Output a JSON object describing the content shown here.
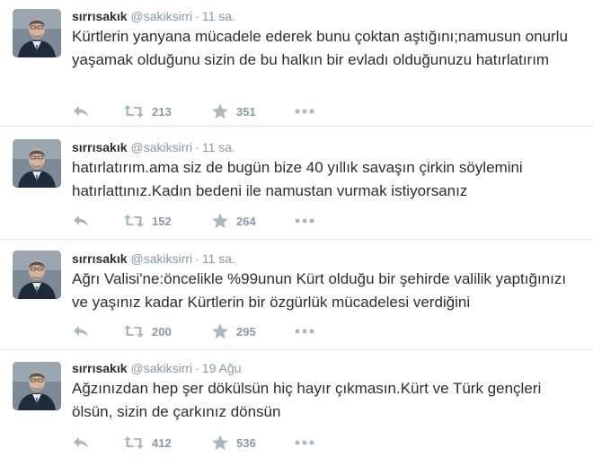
{
  "colors": {
    "text": "#292f33",
    "meta": "#8899a6",
    "divider": "#e1e8ed",
    "action_icon": "#aab8c2"
  },
  "icons": {
    "reply": "reply-icon",
    "retweet": "retweet-icon",
    "favorite": "star-icon",
    "more": "more-icon"
  },
  "tweets": [
    {
      "name": "sırrısakık",
      "handle": "@sakiksirri",
      "separator": "·",
      "time": "11 sa.",
      "text": "Kürtlerin yanyana mücadele ederek bunu çoktan aştığını;namusun onurlu yaşamak olduğunu sizin de bu halkın bir evladı olduğunuzu hatırlatırım",
      "retweets": "213",
      "favorites": "351"
    },
    {
      "name": "sırrısakık",
      "handle": "@sakiksirri",
      "separator": "·",
      "time": "11 sa.",
      "text": "hatırlatırım.ama siz de bugün bize 40 yıllık savaşın çirkin söylemini hatırlattınız.Kadın bedeni ile namustan vurmak istiyorsanız",
      "retweets": "152",
      "favorites": "264"
    },
    {
      "name": "sırrısakık",
      "handle": "@sakiksirri",
      "separator": "·",
      "time": "11 sa.",
      "text": "Ağrı Valisi'ne:öncelikle %99unun Kürt olduğu bir şehirde valilik yaptığınızı ve yaşınız kadar Kürtlerin bir özgürlük mücadelesi verdiğini",
      "retweets": "200",
      "favorites": "295"
    },
    {
      "name": "sırrısakık",
      "handle": "@sakiksirri",
      "separator": "·",
      "time": "19 Ağu",
      "text": "Ağzınızdan hep şer dökülsün hiç hayır çıkmasın.Kürt ve Türk gençleri ölsün, sizin de çarkınız dönsün",
      "retweets": "412",
      "favorites": "536"
    }
  ]
}
